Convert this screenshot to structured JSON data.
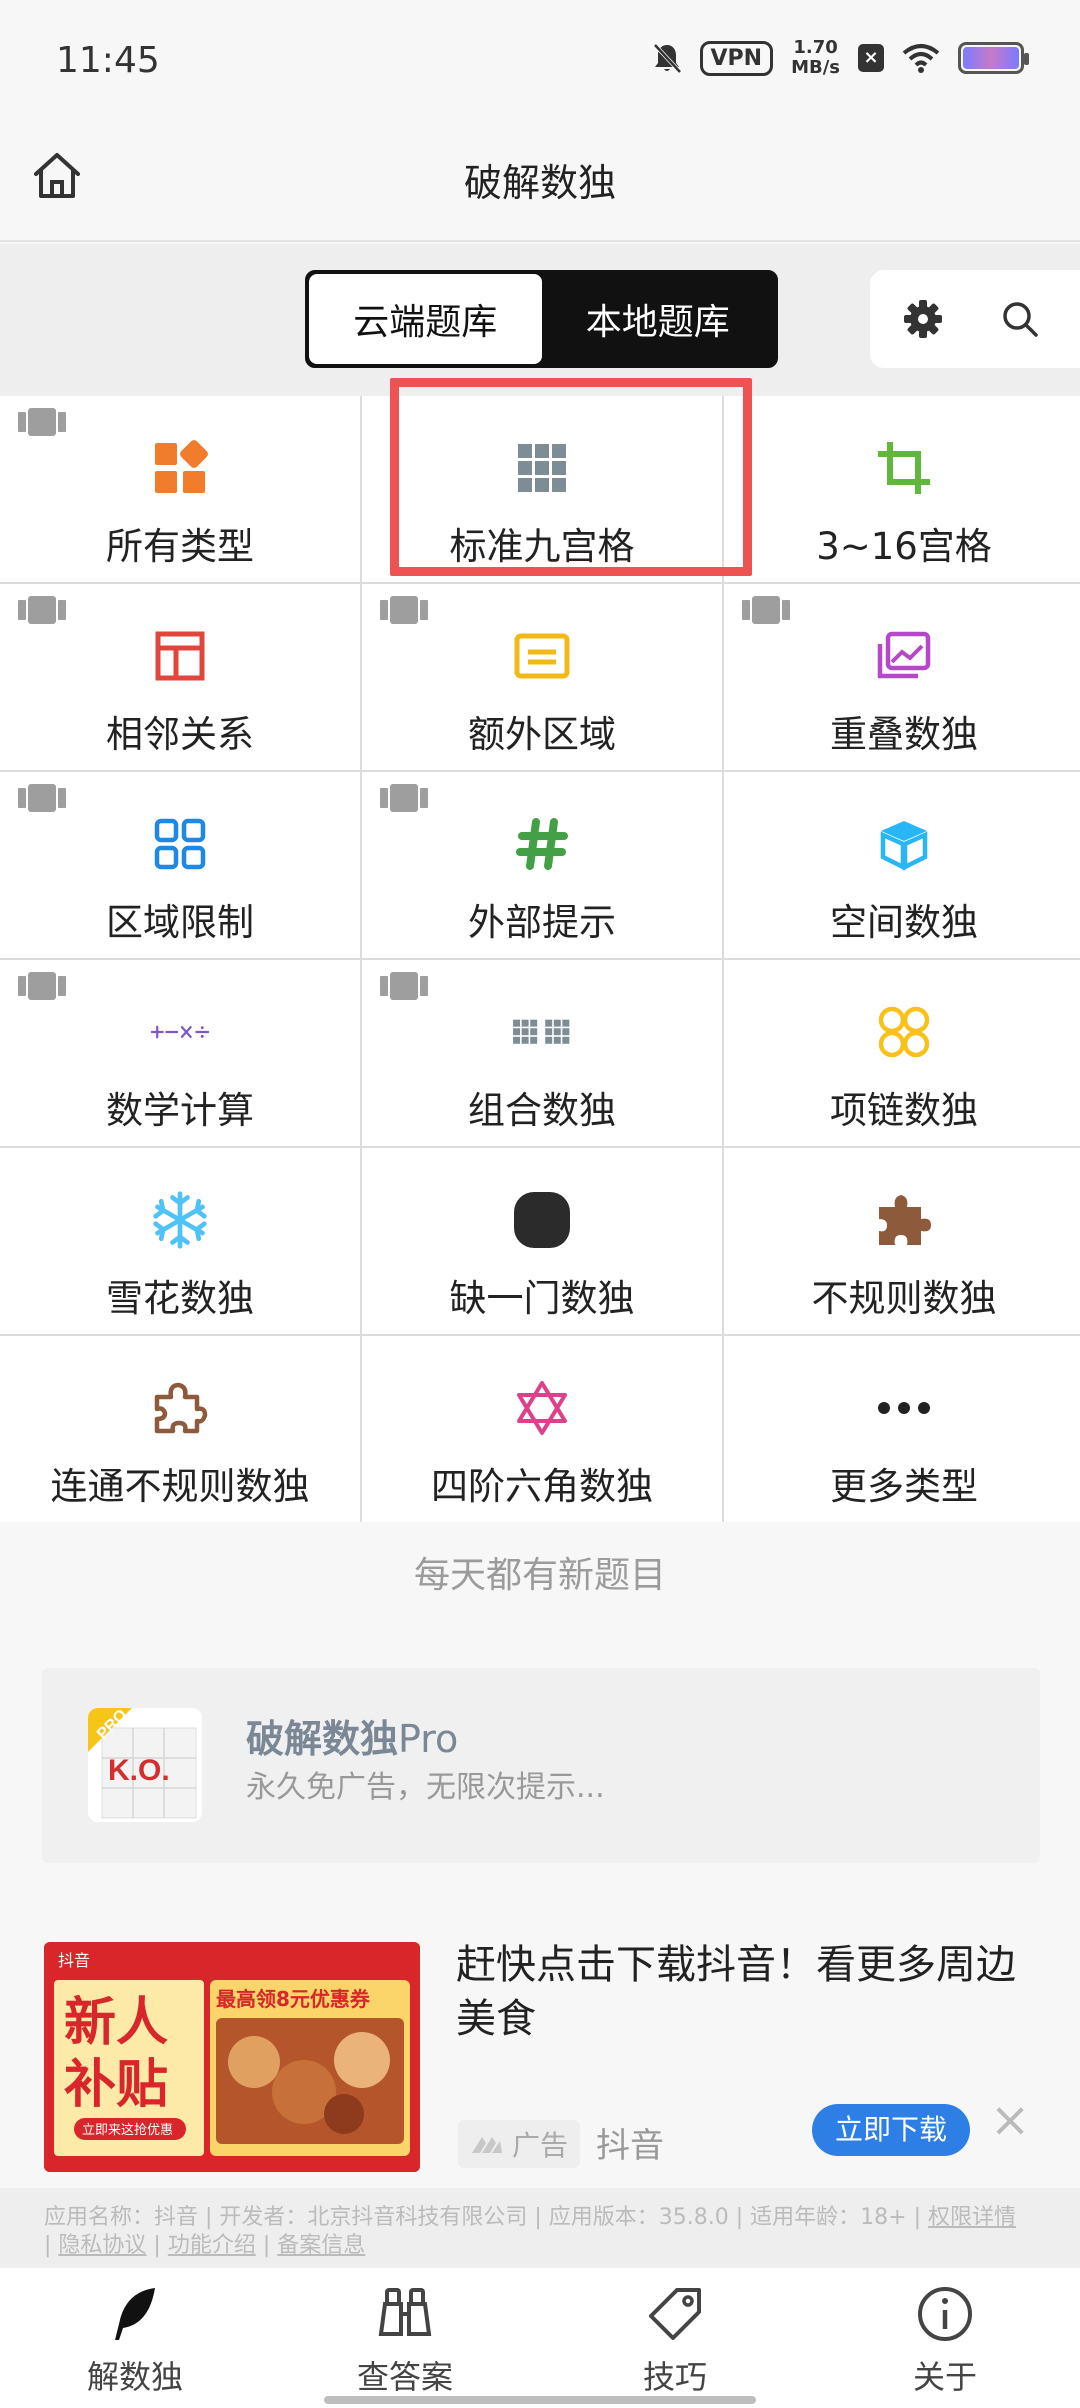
{
  "status_bar": {
    "time": "11:45",
    "vpn": "VPN",
    "speed_value": "1.70",
    "speed_unit": "MB/s"
  },
  "header": {
    "title": "破解数独"
  },
  "tabs": {
    "cloud": "云端题库",
    "local": "本地题库"
  },
  "categories": [
    {
      "label": "所有类型",
      "icon": "four-shapes-icon",
      "color": "#f07c2c"
    },
    {
      "label": "标准九宫格",
      "icon": "grid-3x3-icon",
      "color": "#7e8c96"
    },
    {
      "label": "3~16宫格",
      "icon": "crop-icon",
      "color": "#5fb83c"
    },
    {
      "label": "相邻关系",
      "icon": "layout-icon",
      "color": "#e2453c"
    },
    {
      "label": "额外区域",
      "icon": "card-icon",
      "color": "#f0b917"
    },
    {
      "label": "重叠数独",
      "icon": "photos-icon",
      "color": "#b548c6"
    },
    {
      "label": "区域限制",
      "icon": "four-squares-icon",
      "color": "#1e88e5"
    },
    {
      "label": "外部提示",
      "icon": "hashtag-icon",
      "color": "#43a047"
    },
    {
      "label": "空间数独",
      "icon": "cube-icon",
      "color": "#29b6f6"
    },
    {
      "label": "数学计算",
      "icon": "math-operators-icon",
      "color": "#7e57c2"
    },
    {
      "label": "组合数独",
      "icon": "double-grid-icon",
      "color": "#7e8c96"
    },
    {
      "label": "项链数独",
      "icon": "necklace-icon",
      "color": "#f9c21b"
    },
    {
      "label": "雪花数独",
      "icon": "snowflake-icon",
      "color": "#4fc3f7"
    },
    {
      "label": "缺一门数独",
      "icon": "rounded-square-icon",
      "color": "#2b2b2b"
    },
    {
      "label": "不规则数独",
      "icon": "puzzle-piece-icon",
      "color": "#8d5a3b"
    },
    {
      "label": "连通不规则数独",
      "icon": "puzzle-outline-icon",
      "color": "#8d5a3b"
    },
    {
      "label": "四阶六角数独",
      "icon": "hexagram-icon",
      "color": "#e0408a"
    },
    {
      "label": "更多类型",
      "icon": "more-dots-icon",
      "color": "#222222"
    }
  ],
  "daily_text": "每天都有新题目",
  "promo": {
    "title_bold": "破解数独",
    "title_rest": "Pro",
    "subtitle": "永久免广告，无限次提示...",
    "logo_text": "K.O.",
    "logo_badge": "PRO"
  },
  "ad": {
    "image_brand": "抖音",
    "image_line1": "新人",
    "image_line2": "补贴",
    "image_button": "立即来这抢优惠",
    "image_coupon": "最高领8元优惠券",
    "title": "赶快点击下载抖音！看更多周边美食",
    "tag": "广告",
    "brand": "抖音",
    "download_label": "立即下载"
  },
  "disclaimer": {
    "text": "应用名称：抖音 | 开发者：北京抖音科技有限公司 | 应用版本：35.8.0 | 适用年龄：18+ | ",
    "link1": "权限详情",
    "link2": "隐私协议",
    "link3": "功能介绍",
    "link4": "备案信息"
  },
  "bottom_nav": [
    {
      "label": "解数独",
      "icon": "feather-icon"
    },
    {
      "label": "查答案",
      "icon": "binoculars-icon"
    },
    {
      "label": "技巧",
      "icon": "tag-icon"
    },
    {
      "label": "关于",
      "icon": "info-icon"
    }
  ],
  "colors": {
    "highlight": "#ee5253",
    "accent_blue": "#2d7fe6"
  }
}
